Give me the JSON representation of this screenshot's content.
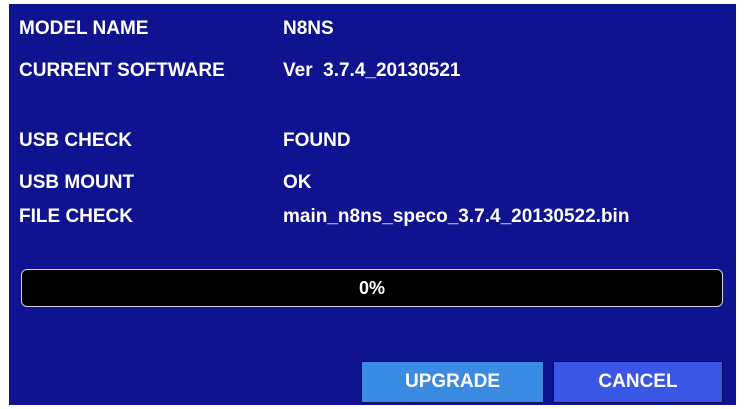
{
  "info": {
    "model_name": {
      "label": "MODEL NAME",
      "value": "N8NS"
    },
    "current_software": {
      "label": "CURRENT SOFTWARE",
      "value": "Ver  3.7.4_20130521"
    },
    "usb_check": {
      "label": "USB CHECK",
      "value": "FOUND"
    },
    "usb_mount": {
      "label": "USB MOUNT",
      "value": "OK"
    },
    "file_check": {
      "label": "FILE CHECK",
      "value": "main_n8ns_speco_3.7.4_20130522.bin"
    }
  },
  "progress": {
    "percent_text": "0%",
    "percent": 0
  },
  "buttons": {
    "upgrade_label": "UPGRADE",
    "cancel_label": "CANCEL"
  },
  "colors": {
    "background": "#0f1390",
    "progress_track": "#000000",
    "upgrade_button": "#3c8be3",
    "cancel_button": "#3a56e4",
    "text": "#ffffff"
  }
}
